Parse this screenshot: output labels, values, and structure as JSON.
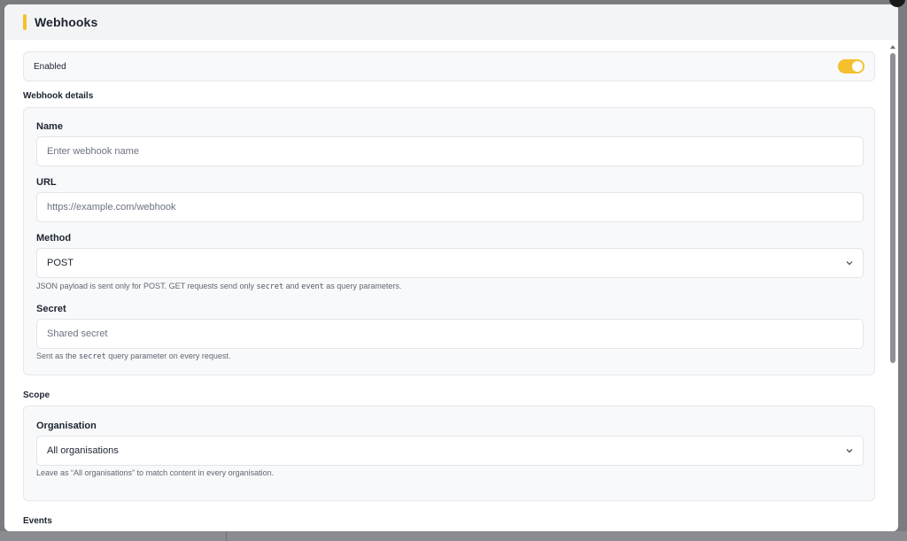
{
  "header": {
    "title": "Webhooks"
  },
  "enabled": {
    "label": "Enabled",
    "on": true
  },
  "sections": {
    "details": "Webhook details",
    "scope": "Scope",
    "events": "Events"
  },
  "fields": {
    "name": {
      "label": "Name",
      "placeholder": "Enter webhook name"
    },
    "url": {
      "label": "URL",
      "placeholder": "https://example.com/webhook"
    },
    "method": {
      "label": "Method",
      "value": "POST",
      "hint_prefix": "JSON payload is sent only for POST. GET requests send only ",
      "hint_code1": "secret",
      "hint_mid": " and ",
      "hint_code2": "event",
      "hint_suffix": " as query parameters."
    },
    "secret": {
      "label": "Secret",
      "placeholder": "Shared secret",
      "hint_prefix": "Sent as the ",
      "hint_code": "secret",
      "hint_suffix": " query parameter on every request."
    },
    "organisation": {
      "label": "Organisation",
      "value": "All organisations",
      "hint": "Leave as “All organisations” to match content in every organisation."
    }
  },
  "colors": {
    "accent": "#f5c02c",
    "card_bg": "#f8f9fa",
    "header_bg": "#f3f4f6"
  },
  "icons": {
    "select_chevron": "chevron-down-icon",
    "scroll_up": "arrow-up-icon"
  }
}
